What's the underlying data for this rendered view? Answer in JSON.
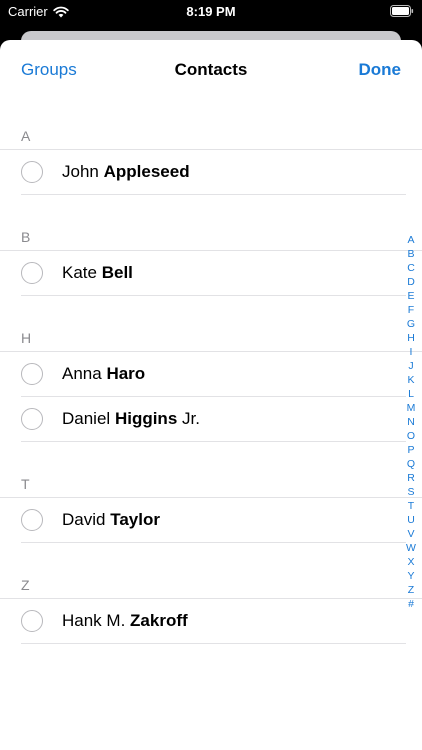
{
  "status_bar": {
    "carrier": "Carrier",
    "time": "8:19 PM"
  },
  "nav": {
    "left_button": "Groups",
    "title": "Contacts",
    "right_button": "Done"
  },
  "sections": [
    {
      "letter": "A",
      "contacts": [
        {
          "first": "John",
          "last": "Appleseed",
          "suffix": ""
        }
      ]
    },
    {
      "letter": "B",
      "contacts": [
        {
          "first": "Kate",
          "last": "Bell",
          "suffix": ""
        }
      ]
    },
    {
      "letter": "H",
      "contacts": [
        {
          "first": "Anna",
          "last": "Haro",
          "suffix": ""
        },
        {
          "first": "Daniel",
          "last": "Higgins",
          "suffix": "Jr."
        }
      ]
    },
    {
      "letter": "T",
      "contacts": [
        {
          "first": "David",
          "last": "Taylor",
          "suffix": ""
        }
      ]
    },
    {
      "letter": "Z",
      "contacts": [
        {
          "first": "Hank M.",
          "last": "Zakroff",
          "suffix": ""
        }
      ]
    }
  ],
  "index_letters": [
    "A",
    "B",
    "C",
    "D",
    "E",
    "F",
    "G",
    "H",
    "I",
    "J",
    "K",
    "L",
    "M",
    "N",
    "O",
    "P",
    "Q",
    "R",
    "S",
    "T",
    "U",
    "V",
    "W",
    "X",
    "Y",
    "Z",
    "#"
  ],
  "colors": {
    "accent": "#1a7ad6",
    "section_text": "#8a8a8e",
    "separator": "#e2e2e5"
  }
}
